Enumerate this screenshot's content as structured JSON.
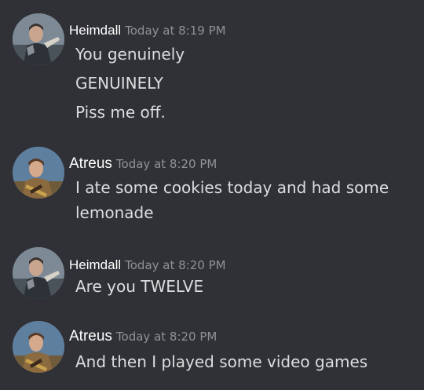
{
  "messages": [
    {
      "author": "Heimdall",
      "timestamp": "Today at 8:19 PM",
      "lines": [
        "You genuinely",
        "GENUINELY",
        "Piss me off."
      ]
    },
    {
      "author": "Atreus",
      "timestamp": "Today at 8:20 PM",
      "lines": [
        "I ate some cookies today and had some",
        "lemonade"
      ]
    },
    {
      "author": "Heimdall",
      "timestamp": "Today at 8:20 PM",
      "lines": [
        "Are you TWELVE"
      ]
    },
    {
      "author": "Atreus",
      "timestamp": "Today at 8:20 PM",
      "lines": [
        "And then I played some video games"
      ]
    }
  ],
  "colors": {
    "background": "#303136",
    "username": "#ffffff",
    "timestamp": "#8e9297",
    "message_text": "#dcddde"
  },
  "avatars": {
    "heimdall": "heimdall-avatar",
    "atreus": "atreus-avatar"
  }
}
